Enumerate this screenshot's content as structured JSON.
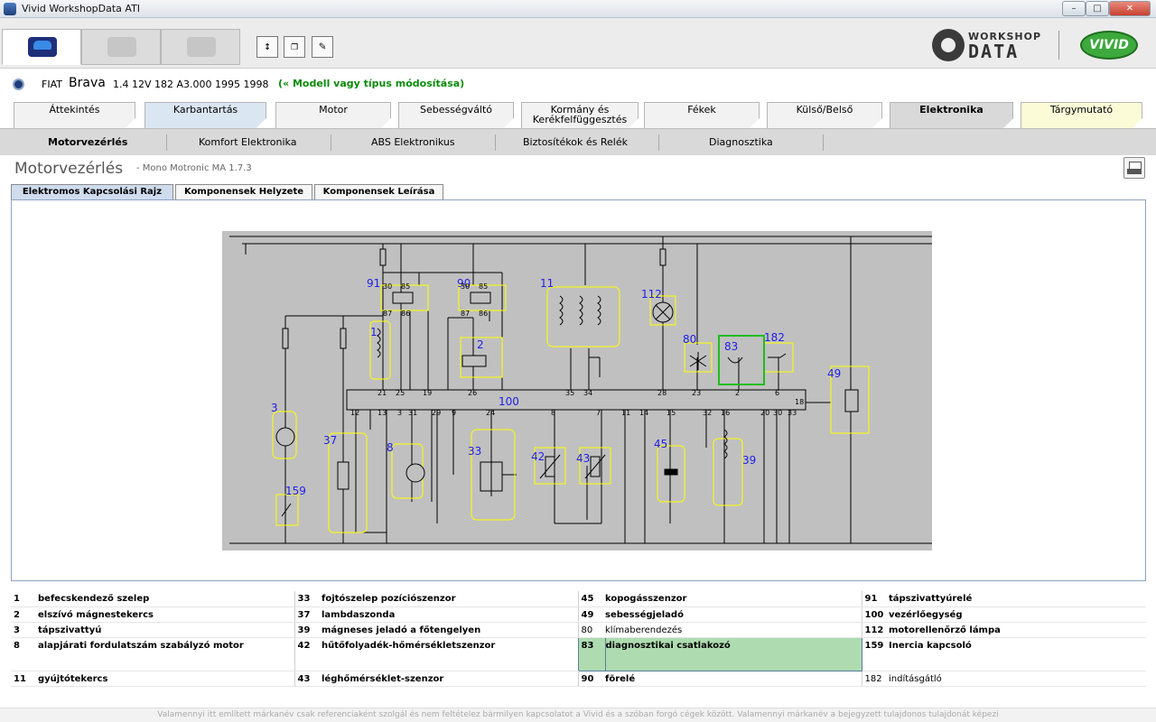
{
  "window": {
    "title": "Vivid WorkshopData ATI"
  },
  "brand": {
    "workshop": "WORKSHOP",
    "data": "DATA",
    "vivid": "VIVID"
  },
  "vehicle": {
    "make": "FIAT",
    "model": "Brava",
    "spec": "1.4 12V 182 A3.000 1995 1998",
    "modify_link": "(« Modell vagy típus módosítása)"
  },
  "main_tabs": [
    {
      "label": "Áttekintés"
    },
    {
      "label": "Karbantartás"
    },
    {
      "label": "Motor"
    },
    {
      "label": "Sebességváltó"
    },
    {
      "label": "Kormány és Kerékfelfüggesztés"
    },
    {
      "label": "Fékek"
    },
    {
      "label": "Külső/Belső"
    },
    {
      "label": "Elektronika",
      "active": true
    },
    {
      "label": "Tárgymutató"
    }
  ],
  "sub_nav": [
    {
      "label": "Motorvezérlés",
      "active": true
    },
    {
      "label": "Komfort Elektronika"
    },
    {
      "label": "ABS Elektronikus"
    },
    {
      "label": "Biztosítékok és Relék"
    },
    {
      "label": "Diagnosztika"
    }
  ],
  "page": {
    "title": "Motorvezérlés",
    "subtitle": "- Mono Motronic MA 1.7.3"
  },
  "content_tabs": [
    {
      "label": "Elektromos Kapcsolási Rajz",
      "active": true
    },
    {
      "label": "Komponensek Helyzete"
    },
    {
      "label": "Komponensek Leírása"
    }
  ],
  "diagram": {
    "component_labels": [
      "91",
      "90",
      "11",
      "112",
      "1",
      "2",
      "80",
      "83",
      "182",
      "49",
      "3",
      "100",
      "37",
      "8",
      "33",
      "42",
      "43",
      "45",
      "39",
      "159"
    ],
    "relay_91": {
      "terminals": [
        "30",
        "85",
        "87",
        "86"
      ]
    },
    "relay_90": {
      "terminals": [
        "30",
        "85",
        "87",
        "86"
      ]
    },
    "ecu_pins_top": [
      "21",
      "25",
      "19",
      "26",
      "35",
      "34",
      "28",
      "23",
      "2",
      "6",
      "18"
    ],
    "ecu_pins_bottom": [
      "12",
      "13",
      "3",
      "31",
      "29",
      "9",
      "24",
      "8",
      "7",
      "11",
      "14",
      "15",
      "32",
      "16",
      "20",
      "30",
      "33"
    ]
  },
  "legend": [
    [
      {
        "num": "1",
        "label": "befecskendező szelep"
      },
      {
        "num": "33",
        "label": "fojtószelep pozíciószenzor"
      },
      {
        "num": "45",
        "label": "kopogásszenzor"
      },
      {
        "num": "91",
        "label": "tápszivattyúrelé"
      }
    ],
    [
      {
        "num": "2",
        "label": "elszívó mágnestekercs"
      },
      {
        "num": "37",
        "label": "lambdaszonda"
      },
      {
        "num": "49",
        "label": "sebességjeladó"
      },
      {
        "num": "100",
        "label": "vezérlőegység"
      }
    ],
    [
      {
        "num": "3",
        "label": "tápszivattyú"
      },
      {
        "num": "39",
        "label": "mágneses jeladó a főtengelyen"
      },
      {
        "num": "80",
        "label": "klímaberendezés",
        "plain": true
      },
      {
        "num": "112",
        "label": "motorellenőrző lámpa"
      }
    ],
    [
      {
        "num": "8",
        "label": "alapjárati fordulatszám szabályzó motor"
      },
      {
        "num": "42",
        "label": "hűtőfolyadék-hőmérsékletszenzor"
      },
      {
        "num": "83",
        "label": "diagnosztikai csatlakozó",
        "highlight": true
      },
      {
        "num": "159",
        "label": "Inercia kapcsoló"
      }
    ],
    [
      {
        "num": "11",
        "label": "gyújtótekercs"
      },
      {
        "num": "43",
        "label": "léghőmérséklet-szenzor"
      },
      {
        "num": "90",
        "label": "fõrelé"
      },
      {
        "num": "182",
        "label": "indításgátló",
        "plain": true
      }
    ]
  ],
  "footer": {
    "text": "Valamennyi itt említett márkanév csak referenciaként szolgál és nem feltételez bármilyen kapcsolatot a Vivid és a szóban forgó cégek között. Valamennyi márkanév a bejegyzett tulajdonos tulajdonát képezi"
  }
}
